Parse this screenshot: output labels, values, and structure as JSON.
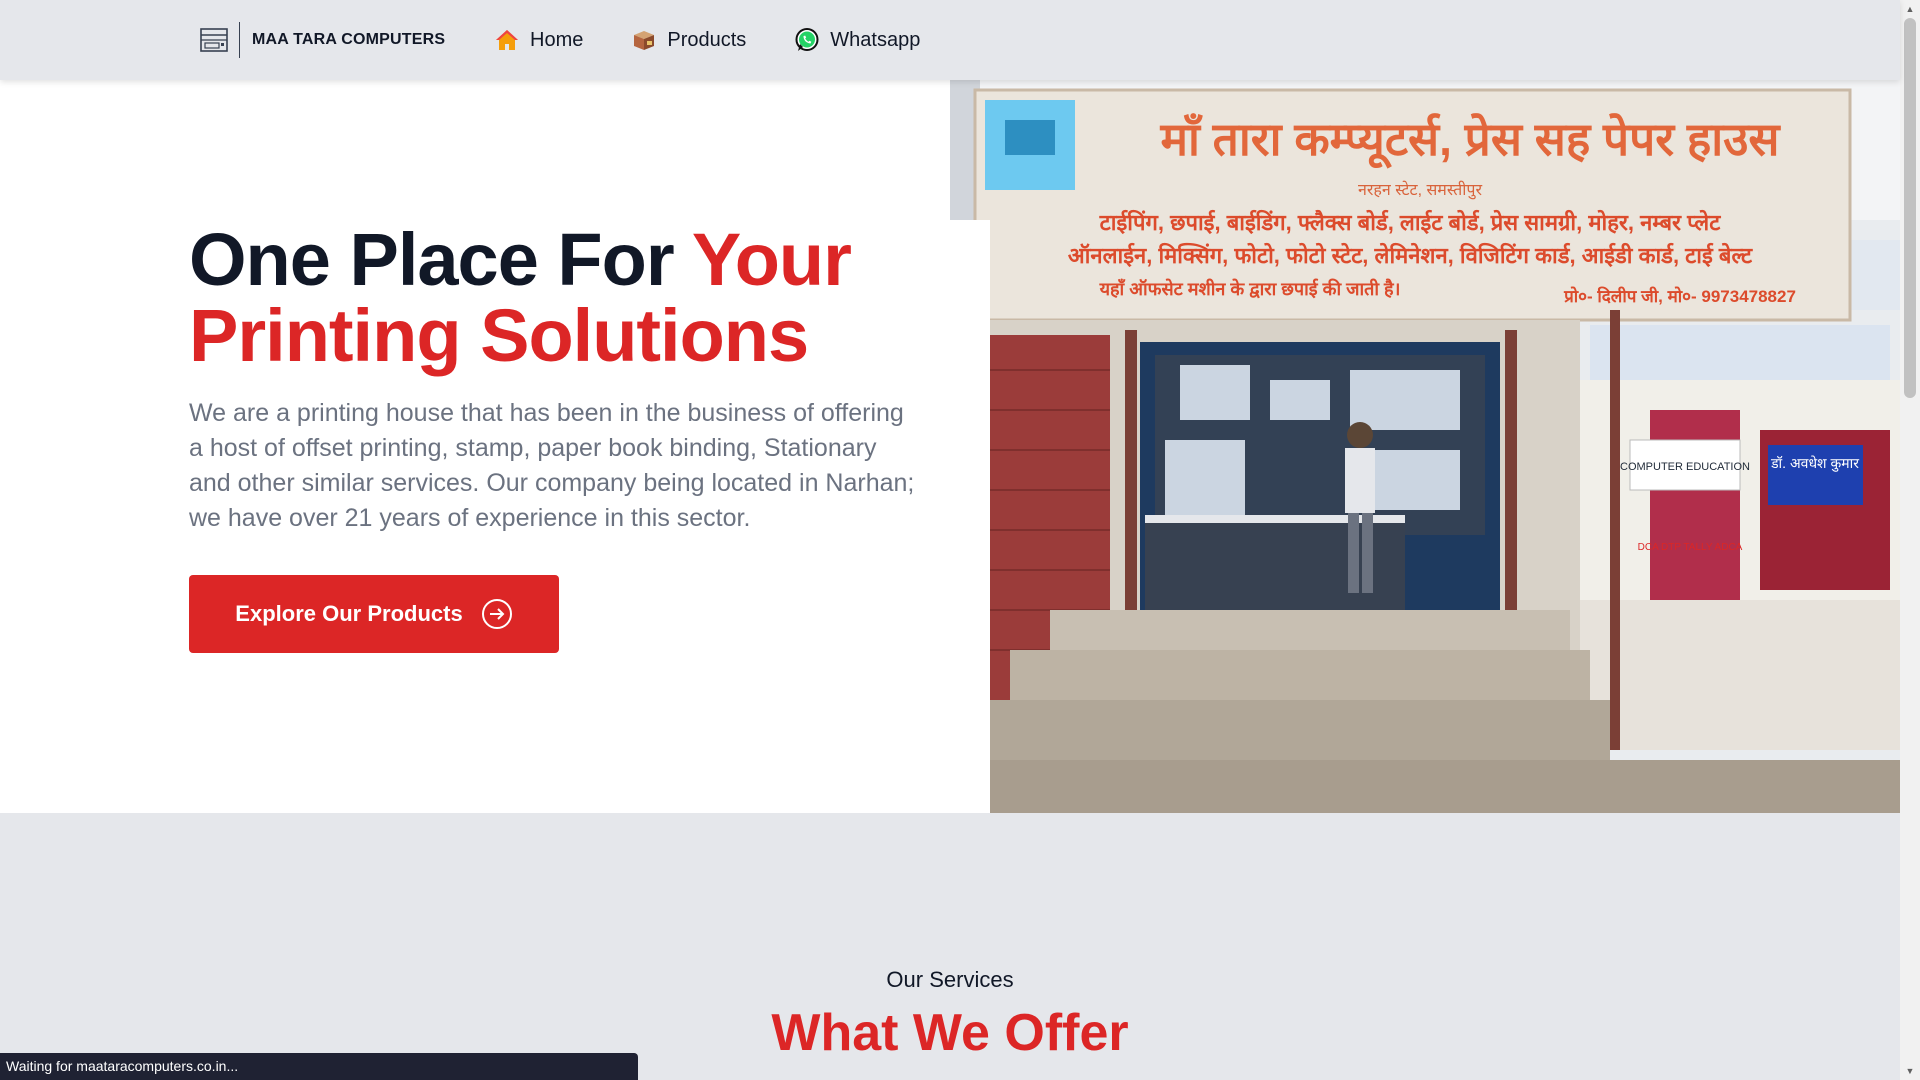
{
  "navbar": {
    "brand_name": "MAA TARA COMPUTERS",
    "brand_icon": "printer-icon",
    "links": [
      {
        "label": "Home",
        "icon": "home-icon"
      },
      {
        "label": "Products",
        "icon": "box-icon"
      },
      {
        "label": "Whatsapp",
        "icon": "whatsapp-icon"
      }
    ]
  },
  "hero": {
    "title_part1": "One Place For ",
    "title_part2": "Your Printing Solutions",
    "description": "We are a printing house that has been in the business of offering a host of offset printing, stamp, paper book binding, Stationary and other similar services. Our company being located in Narhan; we have over 21 years of experience in this sector.",
    "cta_label": "Explore Our Products",
    "cta_icon": "arrow-right-circle-icon"
  },
  "shop_photo": {
    "sign_title": "माँ तारा कम्प्यूटर्स, प्रेस सह पेपर हाउस",
    "sign_subtitle": "नरहन स्टेट, समस्तीपुर",
    "sign_line1": "टाईपिंग, छपाई, बाईडिंग, फ्लैक्स बोर्ड, लाईट बोर्ड, प्रेस सामग्री, मोहर, नम्बर प्लेट",
    "sign_line2": "ऑनलाईन, मिक्सिंग, फोटो, फोटो स्टेट, लेमिनेशन, विजिटिंग कार्ड, आईडी कार्ड, टाई बेल्ट",
    "sign_line3": "यहाँ ऑफसेट मशीन के द्वारा छपाई की जाती है।",
    "sign_contact": "प्रो०- दिलीप जी, मो०- 9973478827",
    "side_sign": "COMPUTER EDUCATION",
    "side_sign_list": "DCA DTP TALLY ADCA",
    "doctor_sign": "डॉ. अवधेश कुमार"
  },
  "services": {
    "kicker": "Our Services",
    "title": "What We Offer"
  },
  "status_bar": {
    "text": "Waiting for maataracomputers.co.in..."
  },
  "colors": {
    "accent": "#dc2626",
    "navbar_bg": "#e5e7eb",
    "heading": "#111827",
    "body_text": "#6b7280",
    "status_bg": "#1f2233"
  }
}
